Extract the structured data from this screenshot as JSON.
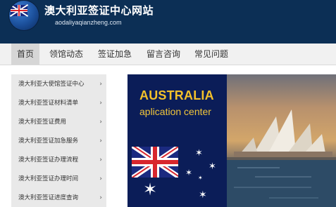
{
  "header": {
    "title": "澳大利亚签证中心网站",
    "domain": "aodaliyaqianzheng.com"
  },
  "nav": {
    "items": [
      {
        "label": "首页",
        "active": true
      },
      {
        "label": "领馆动态"
      },
      {
        "label": "签证加急"
      },
      {
        "label": "留言咨询"
      },
      {
        "label": "常见问题"
      }
    ]
  },
  "sidebar": {
    "items": [
      {
        "label": "澳大利亚大使馆签证中心"
      },
      {
        "label": "澳大利亚签证材料清单"
      },
      {
        "label": "澳大利亚签证费用"
      },
      {
        "label": "澳大利亚签证加急服务"
      },
      {
        "label": "澳大利亚签证办理流程"
      },
      {
        "label": "澳大利亚签证办理时间"
      },
      {
        "label": "澳大利亚签证进度查询"
      }
    ],
    "arrow": "›"
  },
  "banner": {
    "title": "AUSTRALIA",
    "subtitle": "aplication center",
    "flag_icon": "australian-flag-icon",
    "image_icon": "sydney-opera-house-image"
  },
  "colors": {
    "header_bg": "#0c2f55",
    "nav_bg": "#f1f1f1",
    "nav_active_bg": "#d6d6d6",
    "sidebar_item_bg": "#e9e9e9",
    "banner_left_bg": "#0b1d58",
    "banner_text": "#f4c12a"
  }
}
